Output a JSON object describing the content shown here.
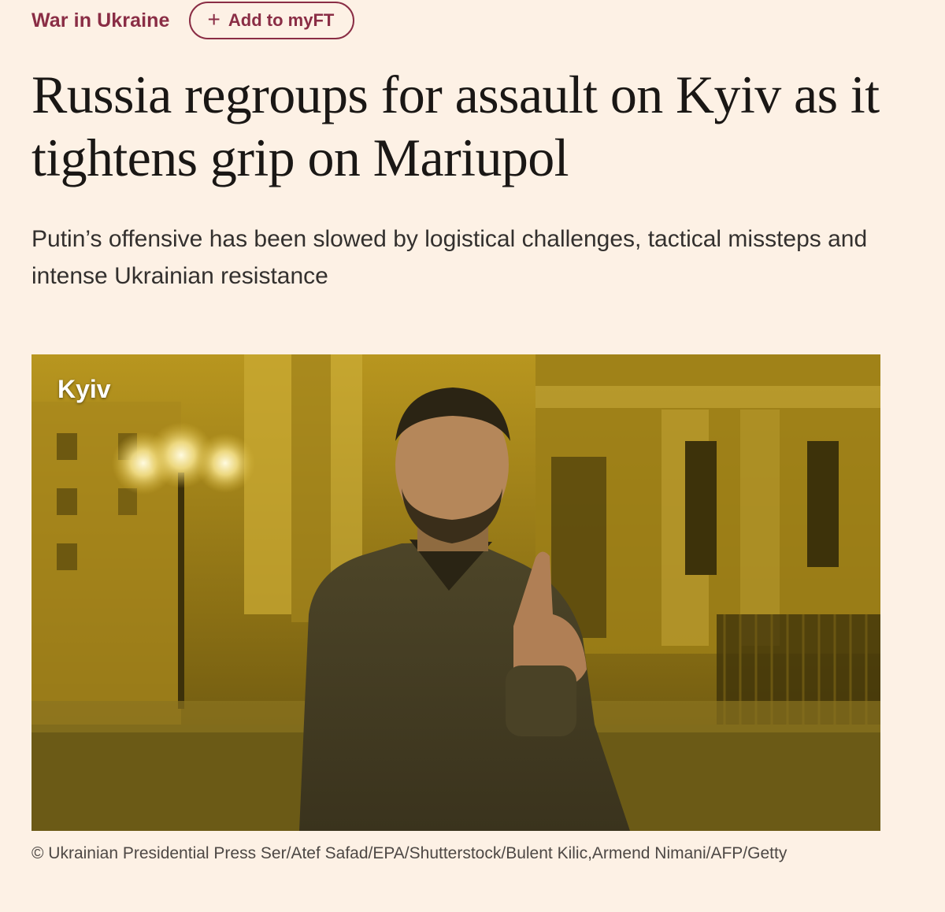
{
  "topic": {
    "label": "War in Ukraine",
    "follow_button_label": "Add to myFT",
    "follow_icon": "plus-icon",
    "accent_color": "#8a2d45"
  },
  "article": {
    "headline": "Russia regroups for assault on Kyiv as it tightens grip on Mariupol",
    "standfirst": "Putin’s offensive has been slowed by logistical challenges, tactical missteps and intense Ukrainian resistance",
    "image": {
      "location_tag": "Kyiv",
      "caption": "© Ukrainian Presidential Press Ser/Atef Safad/EPA/Shutterstock/Bulent Kilic,Armend Nimani/AFP/Getty"
    }
  },
  "colors": {
    "page_background": "#fdf1e5",
    "headline_text": "#1a1715",
    "image_tint": "#c9a52a"
  }
}
